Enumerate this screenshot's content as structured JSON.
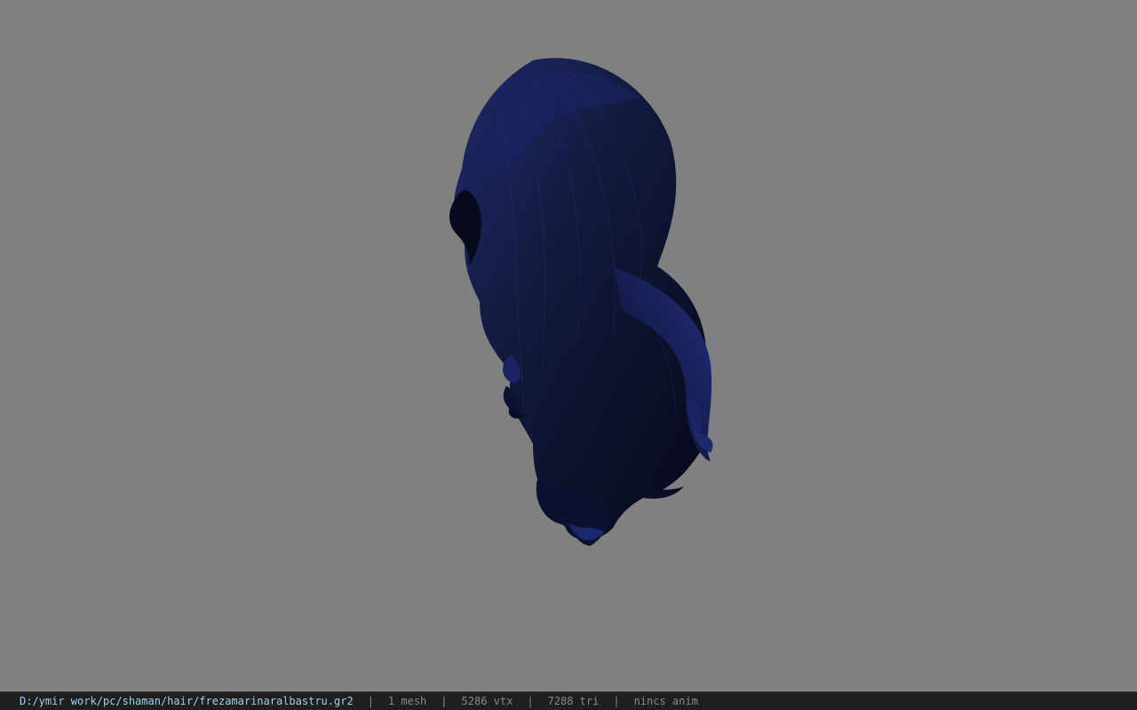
{
  "viewport": {
    "background_color": "#808080",
    "model_color": "#0f1430",
    "model_highlight_color": "#1e2a6a",
    "object_description": "hair-mesh"
  },
  "statusbar": {
    "file_path": "D:/ymir work/pc/shaman/hair/frezamarinaralbastru.gr2",
    "separator": "|",
    "mesh_count": "1 mesh",
    "vertex_count": "5286 vtx",
    "triangle_count": "7288 tri",
    "animation": "nincs anim"
  }
}
